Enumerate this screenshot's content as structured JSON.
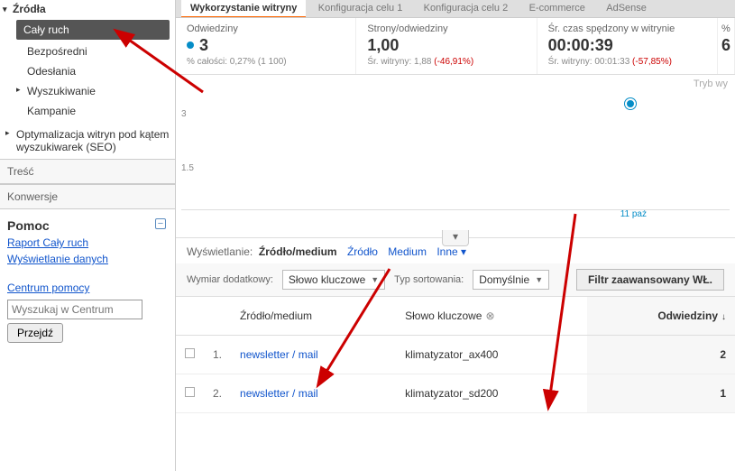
{
  "sidebar": {
    "sections": {
      "sources": {
        "title": "Źródła",
        "items": [
          {
            "label": "Cały ruch",
            "selected": true
          },
          {
            "label": "Bezpośredni"
          },
          {
            "label": "Odesłania"
          },
          {
            "label": "Wyszukiwanie",
            "expandable": true
          },
          {
            "label": "Kampanie"
          }
        ]
      },
      "seo": {
        "label": "Optymalizacja witryn pod kątem wyszukiwarek (SEO)",
        "expandable": true
      },
      "content": {
        "label": "Treść"
      },
      "conversions": {
        "label": "Konwersje"
      }
    },
    "help": {
      "title": "Pomoc",
      "links": [
        "Raport Cały ruch",
        "Wyświetlanie danych",
        "Centrum pomocy"
      ],
      "search_placeholder": "Wyszukaj w Centrum",
      "button": "Przejdź"
    }
  },
  "top_tabs": {
    "items": [
      "Wykorzystanie witryny",
      "Konfiguracja celu 1",
      "Konfiguracja celu 2",
      "E-commerce",
      "AdSense"
    ],
    "active_index": 0
  },
  "metrics": [
    {
      "label": "Odwiedziny",
      "value": "3",
      "sub": "% całości: 0,27% (1 100)",
      "dot": true
    },
    {
      "label": "Strony/odwiedziny",
      "value": "1,00",
      "sub": "Śr. witryny: 1,88 (-46,91%)",
      "neg": "(-46,91%)"
    },
    {
      "label": "Śr. czas spędzony w witrynie",
      "value": "00:00:39",
      "sub": "Śr. witryny: 00:01:33 (-57,85%)",
      "neg": "(-57,85%)"
    },
    {
      "label": "%",
      "value": "6",
      "sub": ""
    }
  ],
  "tryby_label": "Tryb wy",
  "chart_data": {
    "type": "line",
    "yticks": [
      "3",
      "1.5"
    ],
    "xticks": [
      "11 paź"
    ],
    "series": [
      {
        "name": "Odwiedziny",
        "x": [
          "11 paź"
        ],
        "y": [
          3
        ]
      }
    ],
    "ylim": [
      0,
      3
    ]
  },
  "display_row": {
    "label": "Wyświetlanie:",
    "options": [
      "Źródło/medium",
      "Źródło",
      "Medium",
      "Inne"
    ],
    "active_index": 0,
    "other_caret": "▾"
  },
  "filter_row": {
    "secondary_label": "Wymiar dodatkowy:",
    "secondary_value": "Słowo kluczowe",
    "sort_label": "Typ sortowania:",
    "sort_value": "Domyślnie",
    "adv_filter": "Filtr zaawansowany WŁ."
  },
  "table": {
    "columns": [
      {
        "label": "Źródło/medium",
        "key": "source"
      },
      {
        "label": "Słowo kluczowe",
        "key": "keyword",
        "closable": true
      },
      {
        "label": "Odwiedziny",
        "key": "visits",
        "numeric": true,
        "sorted_desc": true
      }
    ],
    "rows": [
      {
        "idx": "1.",
        "source": "newsletter / mail",
        "keyword": "klimatyzator_ax400",
        "visits": "2"
      },
      {
        "idx": "2.",
        "source": "newsletter / mail",
        "keyword": "klimatyzator_sd200",
        "visits": "1"
      }
    ]
  }
}
